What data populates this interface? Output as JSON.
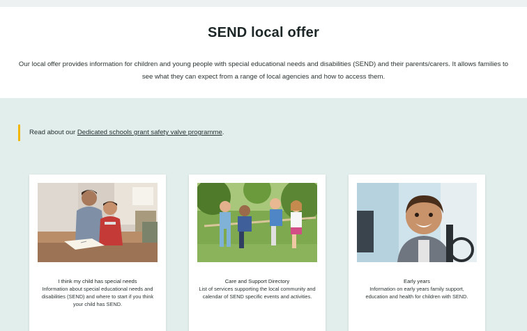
{
  "page": {
    "title": "SEND local offer",
    "intro": "Our local offer provides information for children and young people with special educational needs and disabilities (SEND) and their parents/carers. It allows families to see what they can expect from a range of local agencies and how to access them."
  },
  "callout": {
    "prefix": "Read about our ",
    "link_text": "Dedicated schools grant safety valve programme",
    "suffix": "."
  },
  "cards": [
    {
      "title": "I think my child has special needs",
      "description": "Information about special educational needs and disabilities (SEND) and where to start if you think your child has SEND."
    },
    {
      "title": "Care and Support Directory",
      "description": "List of services supporting the local community and calendar of SEND specific events and activities."
    },
    {
      "title": "Early years",
      "description": "Information on early years family support, education and health for children with SEND."
    }
  ],
  "colors": {
    "band_background": "#e2eeec",
    "callout_accent": "#f2b500",
    "card_background": "#ffffff"
  }
}
